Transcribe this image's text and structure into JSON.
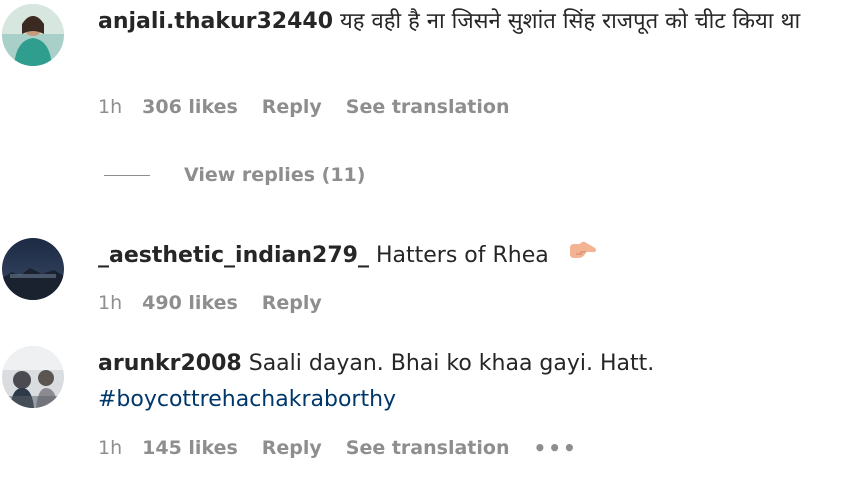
{
  "comments": [
    {
      "username": "anjali.thakur32440",
      "text": "यह वही है ना जिसने सुशांत सिंह राजपूत को चीट किया था",
      "time": "1h",
      "likes": "306 likes",
      "reply": "Reply",
      "translation": "See translation"
    },
    {
      "username": "_aesthetic_indian279_",
      "text": "Hatters of Rhea",
      "emoji": "backhand-index-pointing-right-icon",
      "time": "1h",
      "likes": "490 likes",
      "reply": "Reply"
    },
    {
      "username": "arunkr2008",
      "text": "Saali dayan. Bhai ko khaa gayi. Hatt.",
      "hashtag": "#boycottrehachakraborthy",
      "time": "1h",
      "likes": "145 likes",
      "reply": "Reply",
      "translation": "See translation",
      "more": "•••"
    }
  ],
  "view_replies": "View replies (11)",
  "colors": {
    "text": "#262626",
    "secondary": "#8e8e8e",
    "hashtag": "#00376b"
  }
}
